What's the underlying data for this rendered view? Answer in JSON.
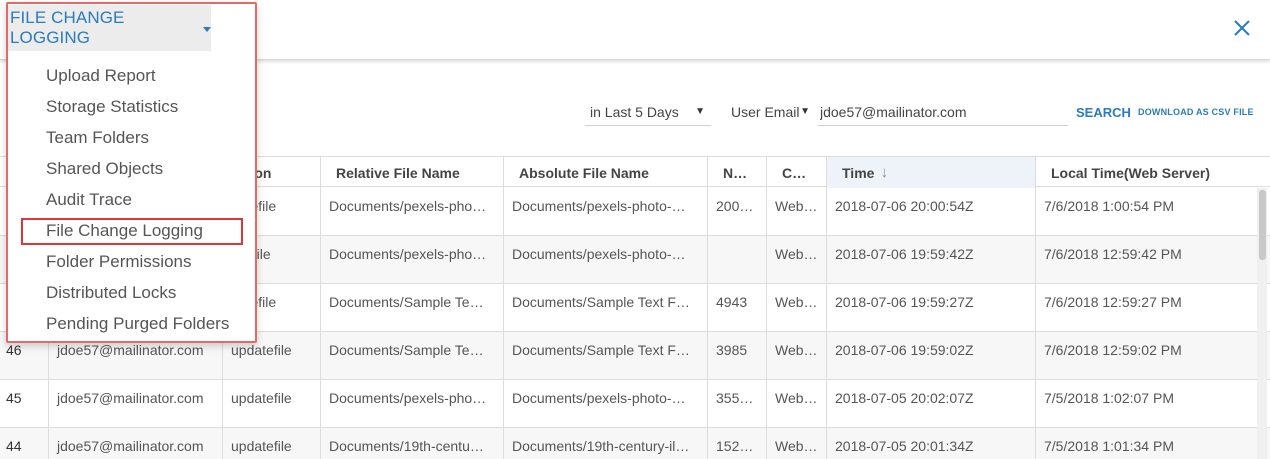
{
  "header": {
    "title": "FILE CHANGE LOGGING"
  },
  "icons": {
    "close": "close-icon",
    "caret": "caret-down-icon",
    "sort": "arrow-down-icon",
    "select_arrow": "triangle-down-icon"
  },
  "menu": {
    "items": [
      "Upload Report",
      "Storage Statistics",
      "Team Folders",
      "Shared Objects",
      "Audit Trace",
      "File Change Logging",
      "Folder Permissions",
      "Distributed Locks",
      "Pending Purged Folders"
    ],
    "highlighted": "File Change Logging"
  },
  "filters": {
    "range": "in Last 5 Days",
    "field": "User Email",
    "value": "jdoe57@mailinator.com",
    "search_label": "SEARCH",
    "csv_label": "DOWNLOAD AS CSV FILE"
  },
  "table": {
    "columns": [
      "ction",
      "Relative File Name",
      "Absolute File Name",
      "N…",
      "C…",
      "Time",
      "Local Time(Web Server)"
    ],
    "rows": [
      [
        "",
        "",
        "datefile",
        "Documents/pexels-pho…",
        "Documents/pexels-photo-…",
        "200…",
        "Web…",
        "2018-07-06 20:00:54Z",
        "7/6/2018 1:00:54 PM"
      ],
      [
        "",
        "",
        "essfile",
        "Documents/pexels-pho…",
        "Documents/pexels-photo-…",
        "",
        "Web…",
        "2018-07-06 19:59:42Z",
        "7/6/2018 12:59:42 PM"
      ],
      [
        "",
        "",
        "datefile",
        "Documents/Sample Te…",
        "Documents/Sample Text F…",
        "4943",
        "Web…",
        "2018-07-06 19:59:27Z",
        "7/6/2018 12:59:27 PM"
      ],
      [
        "46",
        "jdoe57@mailinator.com",
        "updatefile",
        "Documents/Sample Te…",
        "Documents/Sample Text F…",
        "3985",
        "Web…",
        "2018-07-06 19:59:02Z",
        "7/6/2018 12:59:02 PM"
      ],
      [
        "45",
        "jdoe57@mailinator.com",
        "updatefile",
        "Documents/pexels-pho…",
        "Documents/pexels-photo-…",
        "355…",
        "Web…",
        "2018-07-05 20:02:07Z",
        "7/5/2018 1:02:07 PM"
      ],
      [
        "44",
        "jdoe57@mailinator.com",
        "updatefile",
        "Documents/19th-centu…",
        "Documents/19th-century-il…",
        "152…",
        "Web…",
        "2018-07-05 20:01:34Z",
        "7/5/2018 1:01:34 PM"
      ]
    ]
  },
  "colors": {
    "accent": "#2a7bbf",
    "menu_border": "#e46a6a",
    "highlight_border": "#d9383a"
  }
}
